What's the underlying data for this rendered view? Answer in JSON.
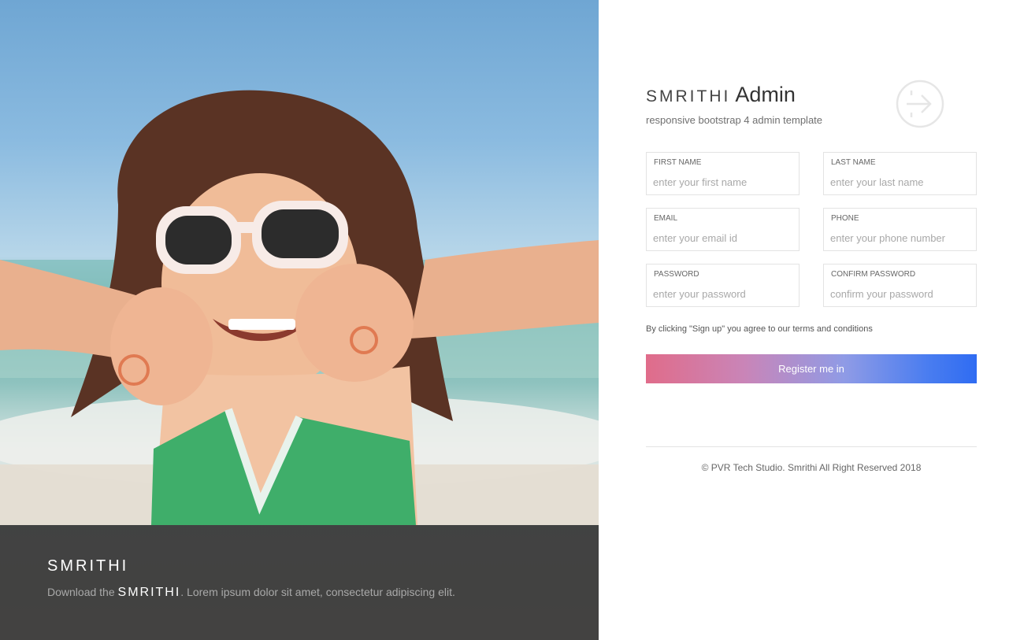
{
  "colors": {
    "overlay": "#1e1e1e",
    "button_start": "#e06c8a",
    "button_end": "#2f6cf2",
    "field_border": "#e3e3e3"
  },
  "hero": {
    "brand": "SMRITHI",
    "text_prefix": "Download the",
    "text_brand": "SMRITHI",
    "text_suffix": ". Lorem ipsum dolor sit amet, consectetur adipiscing elit.",
    "image_subject": "girl-with-sunglasses-on-beach"
  },
  "header": {
    "logo_word": "SMRITHI",
    "admin_word": "Admin",
    "subtitle": "responsive bootstrap 4 admin template",
    "icon": "login-arrow-icon"
  },
  "form": {
    "first_name": {
      "label": "FIRST NAME",
      "placeholder": "enter your first name",
      "value": ""
    },
    "last_name": {
      "label": "LAST NAME",
      "placeholder": "enter your last name",
      "value": ""
    },
    "email": {
      "label": "EMAIL",
      "placeholder": "enter your email id",
      "value": ""
    },
    "phone": {
      "label": "PHONE",
      "placeholder": "enter your phone number",
      "value": ""
    },
    "password": {
      "label": "PASSWORD",
      "placeholder": "enter your password",
      "value": ""
    },
    "confirm_password": {
      "label": "CONFIRM PASSWORD",
      "placeholder": "confirm your password",
      "value": ""
    },
    "terms_text": "By clicking \"Sign up\" you agree to our terms and conditions",
    "submit_label": "Register me in"
  },
  "footer": {
    "copyright": "© PVR Tech Studio. Smrithi All Right Reserved 2018"
  }
}
